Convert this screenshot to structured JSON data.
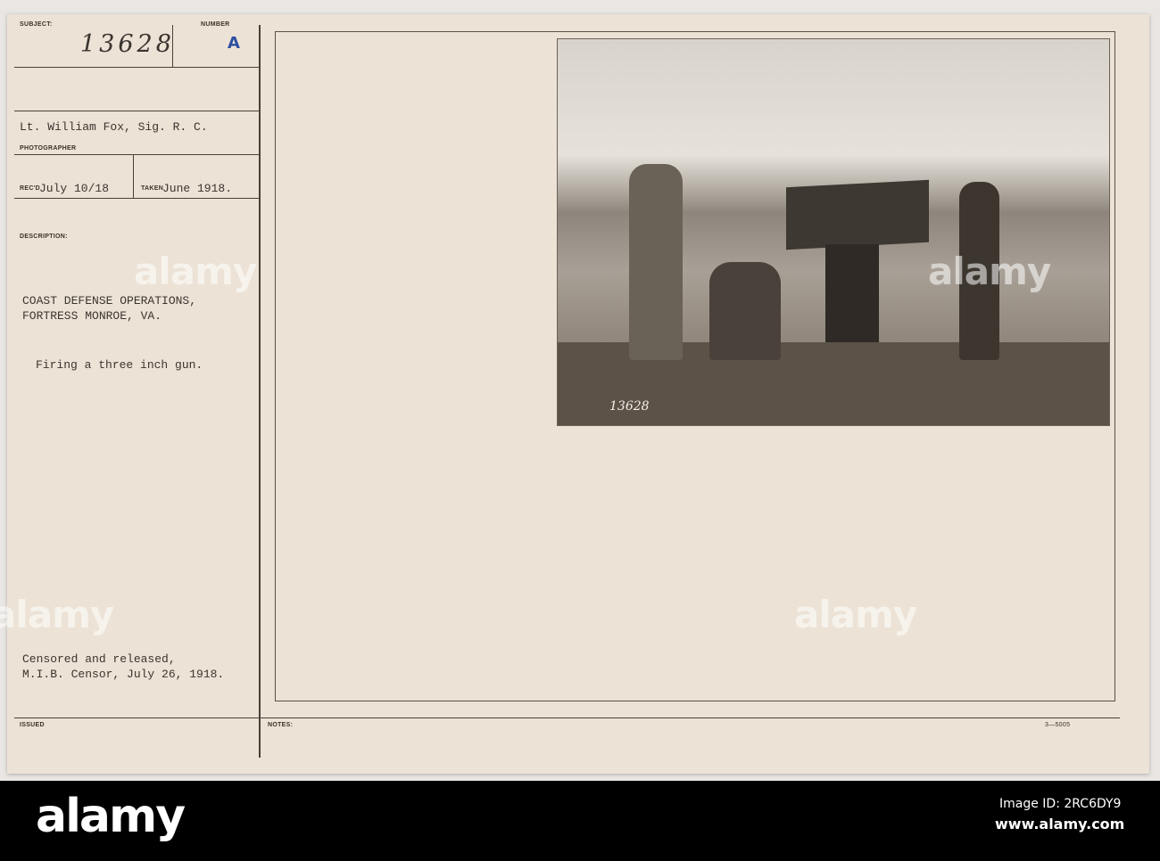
{
  "card": {
    "subject_label": "SUBJECT:",
    "subject_value": "13628",
    "number_label": "NUMBER",
    "number_value": "A",
    "photographer_value": "Lt. William Fox, Sig. R. C.",
    "photographer_label": "PHOTOGRAPHER",
    "received_label": "REC'D",
    "received_value": "July 10/18",
    "taken_label": "TAKEN",
    "taken_value": "June 1918.",
    "description_label": "DESCRIPTION:",
    "description_lines": [
      "COAST DEFENSE OPERATIONS,",
      "FORTRESS MONROE, VA."
    ],
    "caption": "Firing a three inch gun.",
    "censor_lines": [
      "Censored and released,",
      "M.I.B. Censor, July 26, 1918."
    ],
    "issued_label": "ISSUED",
    "notes_label": "NOTES:",
    "form_number": "3—5005",
    "photo_number": "13628",
    "number_color": "#2d4fa0"
  },
  "watermark": "alamy",
  "banner": {
    "logo": "alamy",
    "image_id": "Image ID: 2RC6DY9",
    "url": "www.alamy.com"
  }
}
